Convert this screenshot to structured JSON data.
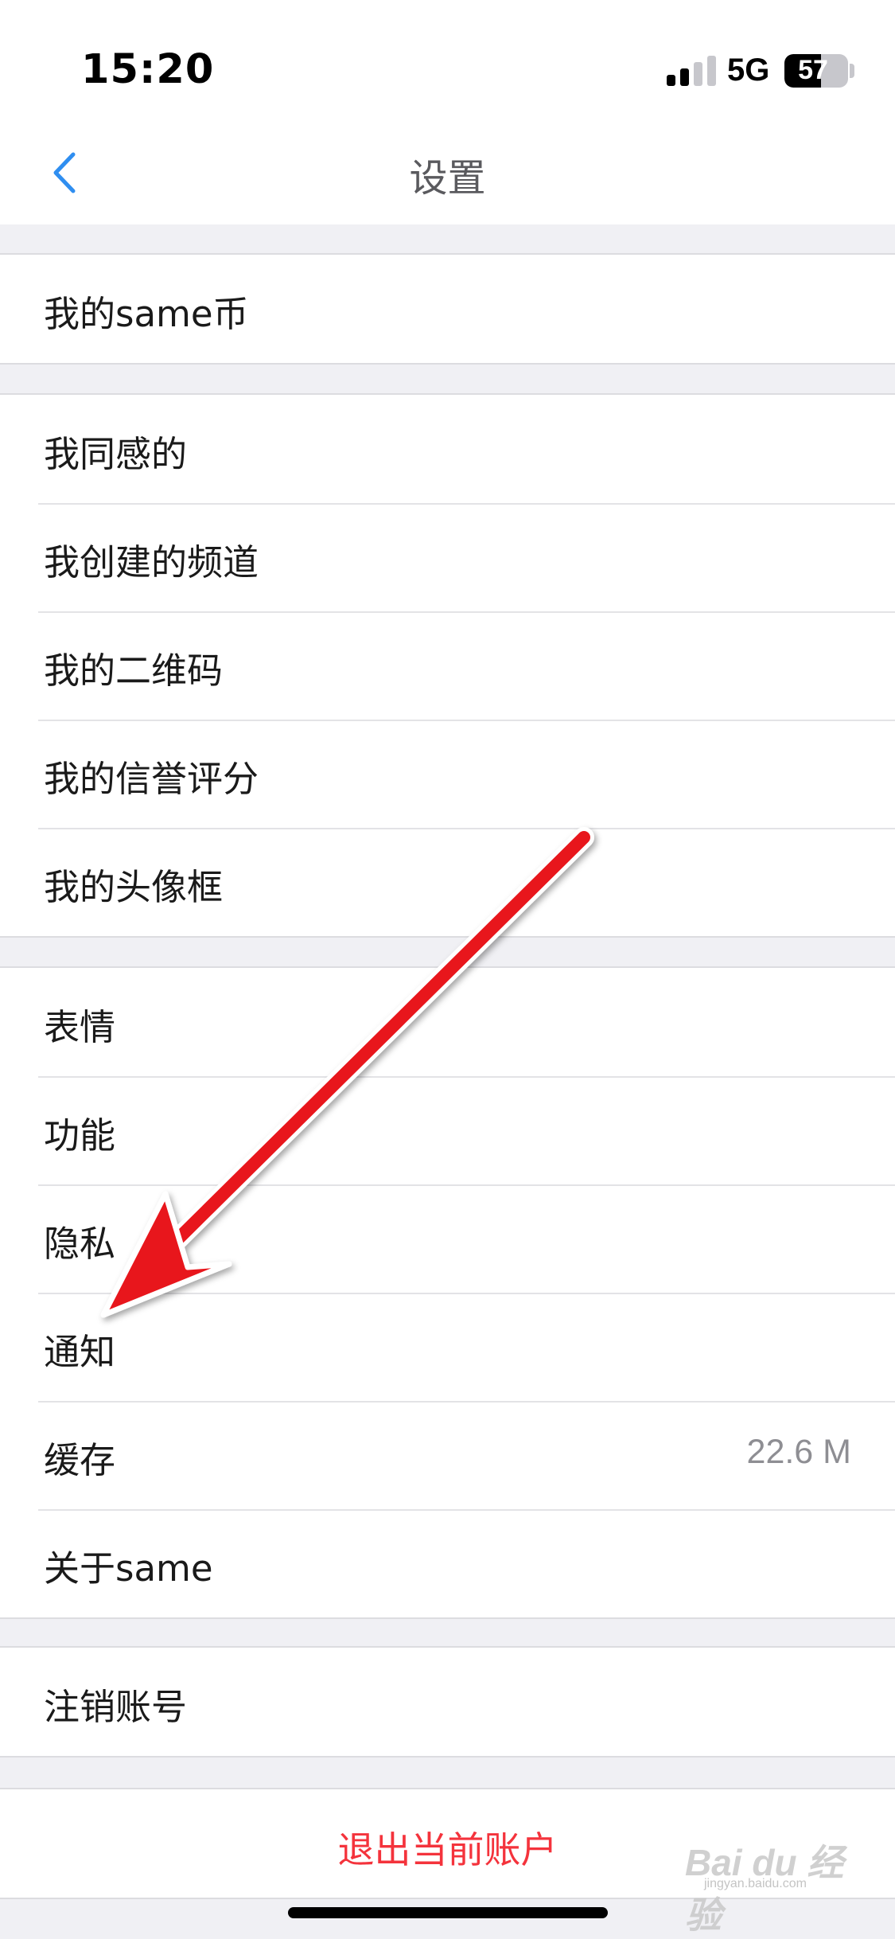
{
  "status_bar": {
    "time": "15:20",
    "network": "5G",
    "battery_percent": "57",
    "battery_level": 0.57
  },
  "nav": {
    "title": "设置",
    "back_icon": "chevron-left-icon"
  },
  "groups": {
    "coins": {
      "items": [
        {
          "label": "我的same币"
        }
      ]
    },
    "profile": {
      "items": [
        {
          "label": "我同感的"
        },
        {
          "label": "我创建的频道"
        },
        {
          "label": "我的二维码"
        },
        {
          "label": "我的信誉评分"
        },
        {
          "label": "我的头像框"
        }
      ]
    },
    "settings": {
      "items": [
        {
          "label": "表情"
        },
        {
          "label": "功能"
        },
        {
          "label": "隐私"
        },
        {
          "label": "通知"
        },
        {
          "label": "缓存",
          "value": "22.6 M"
        },
        {
          "label": "关于same"
        }
      ]
    },
    "account": {
      "items": [
        {
          "label": "注销账号"
        }
      ]
    }
  },
  "logout": {
    "label": "退出当前账户"
  },
  "watermark": {
    "text": "Bai du 经验",
    "subtext": "jingyan.baidu.com"
  },
  "colors": {
    "accent": "#2f8ef0",
    "danger": "#f4333c",
    "annotation_arrow": "#e8171d",
    "background": "#f0f0f4"
  }
}
